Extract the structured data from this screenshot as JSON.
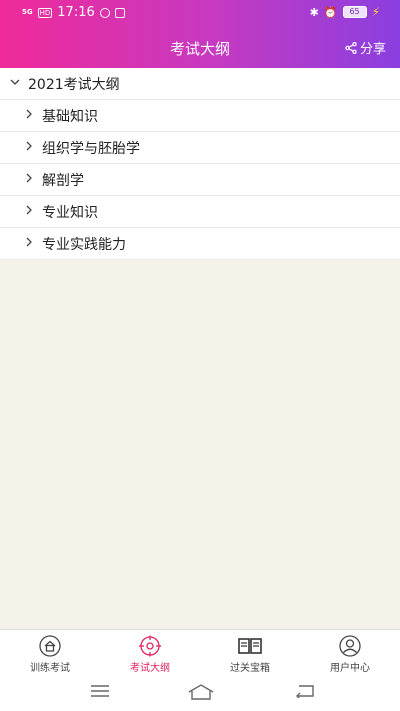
{
  "status_bar": {
    "signal": "5G",
    "hd": "HD",
    "time": "17:16",
    "battery": "65"
  },
  "header": {
    "title": "考试大纲",
    "share_label": "分享"
  },
  "tree": {
    "root_label": "2021考试大纲",
    "children": [
      {
        "label": "基础知识"
      },
      {
        "label": "组织学与胚胎学"
      },
      {
        "label": "解剖学"
      },
      {
        "label": "专业知识"
      },
      {
        "label": "专业实践能力"
      }
    ]
  },
  "bottom_nav": {
    "items": [
      {
        "label": "训练考试",
        "icon": "home-icon"
      },
      {
        "label": "考试大纲",
        "icon": "target-icon",
        "active": true
      },
      {
        "label": "过关宝箱",
        "icon": "book-icon"
      },
      {
        "label": "用户中心",
        "icon": "user-icon"
      }
    ],
    "active_color": "#e0245e"
  },
  "colors": {
    "header_gradient_start": "#f02a9a",
    "header_gradient_end": "#8a3fe0",
    "background": "#f5f2ea"
  }
}
